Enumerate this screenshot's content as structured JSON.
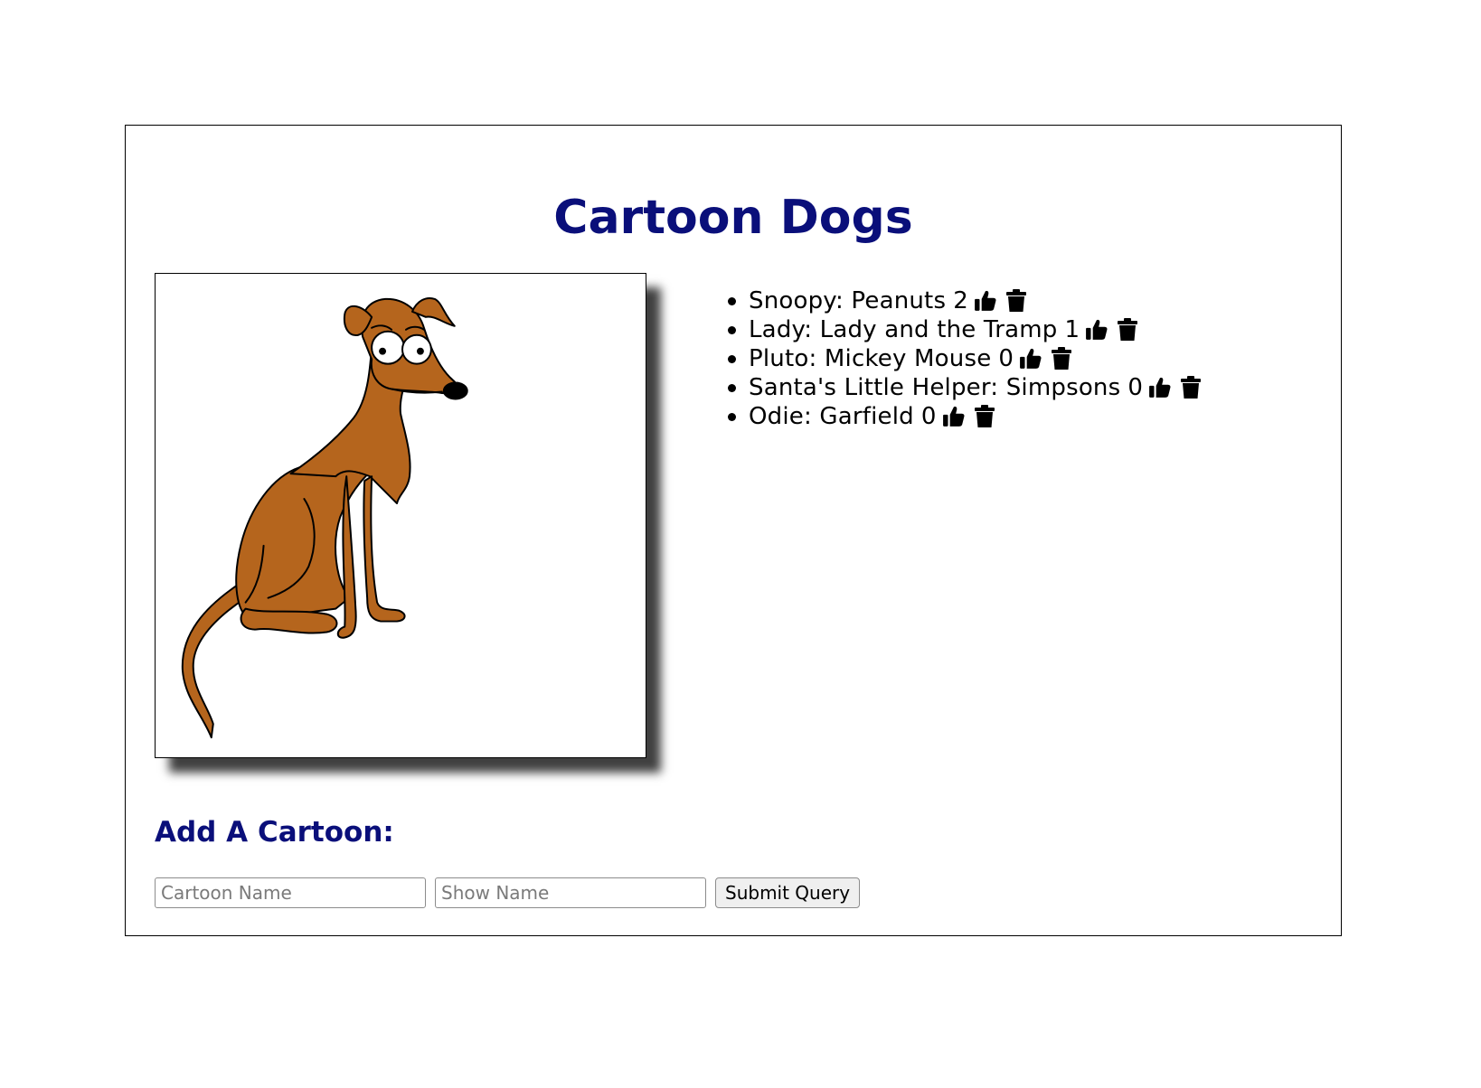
{
  "header": {
    "title": "Cartoon Dogs"
  },
  "colors": {
    "heading": "#0a0f7a",
    "dog_fur": "#b5651d",
    "text": "#000000"
  },
  "dogs": [
    {
      "name": "Snoopy",
      "show": "Peanuts",
      "label": "Snoopy: Peanuts",
      "votes": "2"
    },
    {
      "name": "Lady",
      "show": "Lady and the Tramp",
      "label": "Lady: Lady and the Tramp",
      "votes": "1"
    },
    {
      "name": "Pluto",
      "show": "Mickey Mouse",
      "label": "Pluto: Mickey Mouse",
      "votes": "0"
    },
    {
      "name": "Santa's Little Helper",
      "show": "Simpsons",
      "label": "Santa's Little Helper: Simpsons",
      "votes": "0"
    },
    {
      "name": "Odie",
      "show": "Garfield",
      "label": "Odie: Garfield",
      "votes": "0"
    }
  ],
  "icons": {
    "like": "thumbs-up-icon",
    "delete": "trash-icon"
  },
  "form": {
    "heading": "Add A Cartoon:",
    "cartoon_placeholder": "Cartoon Name",
    "show_placeholder": "Show Name",
    "submit_label": "Submit Query"
  }
}
